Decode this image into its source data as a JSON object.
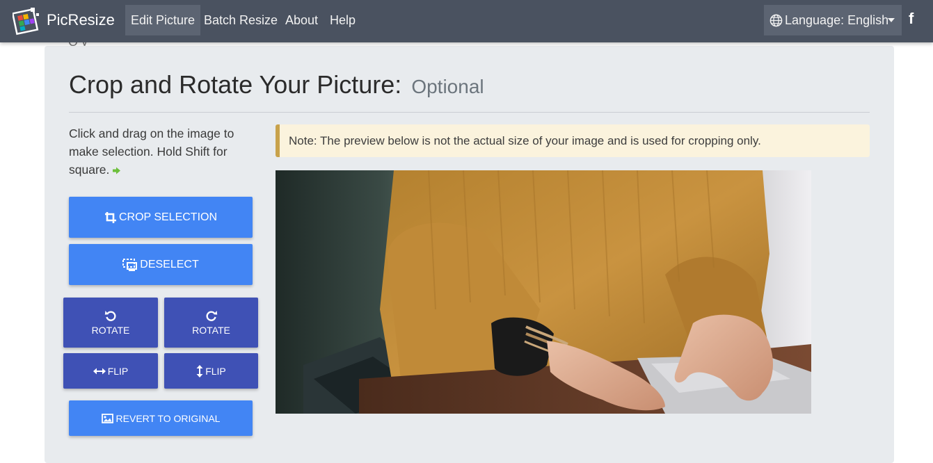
{
  "navbar": {
    "brand": "PicResize",
    "items": [
      {
        "label": "Edit Picture",
        "active": true
      },
      {
        "label": "Batch Resize",
        "active": false
      },
      {
        "label": "About",
        "active": false
      },
      {
        "label": "Help",
        "active": false
      }
    ],
    "language_label": "Language: English",
    "facebook_glyph": "f"
  },
  "page": {
    "peek_text": "Q y",
    "title": "Crop and Rotate Your Picture:",
    "title_muted": "Optional",
    "instructions": "Click and drag on the image to make selection. Hold Shift for square.",
    "note": "Note: The preview below is not the actual size of your image and is used for cropping only."
  },
  "buttons": {
    "crop": "CROP SELECTION",
    "deselect": "DESELECT",
    "rotate_left": "ROTATE",
    "rotate_right": "ROTATE",
    "flip_h": "FLIP",
    "flip_v": "FLIP",
    "revert": "REVERT TO ORIGINAL"
  },
  "icons": {
    "crop": "crop-icon",
    "deselect": "deselect-icon",
    "rotate_left": "rotate-ccw-icon",
    "rotate_right": "rotate-cw-icon",
    "flip_h": "arrows-horizontal-icon",
    "flip_v": "arrows-vertical-icon",
    "revert": "image-icon",
    "language": "globe-icon",
    "facebook": "facebook-icon",
    "hint": "arrow-right-icon"
  },
  "colors": {
    "navbar": "#4a5260",
    "primary": "#4285f4",
    "indigo": "#3f51b5",
    "note_bg": "#fbf3dd",
    "note_border": "#c8a24b",
    "card_bg": "#e8ebee"
  }
}
